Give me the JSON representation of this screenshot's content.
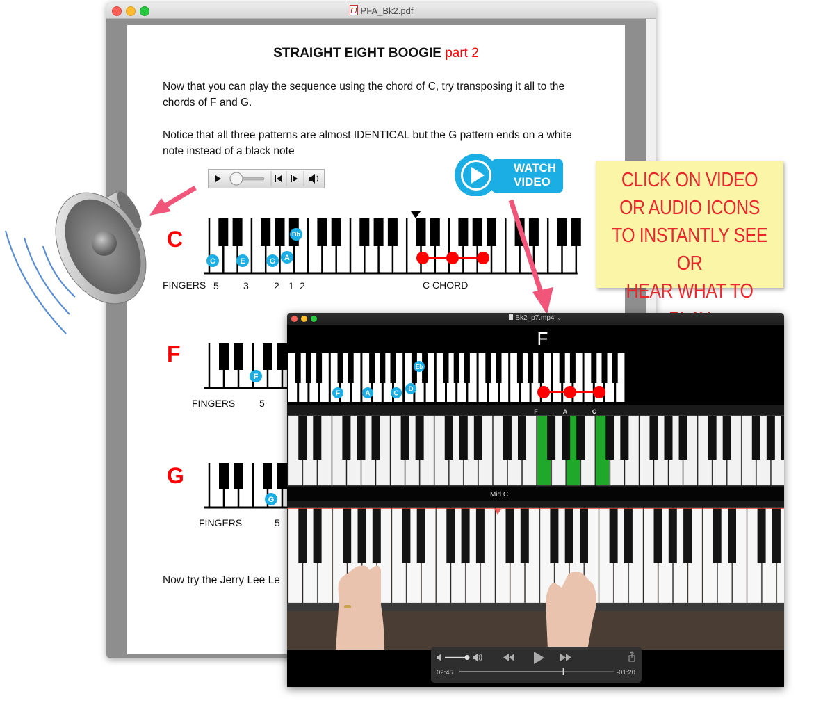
{
  "pdf_window": {
    "title": "PFA_Bk2.pdf",
    "doc_title_main": "STRAIGHT EIGHT BOOGIE",
    "doc_title_suffix": "part 2",
    "paragraph1": "Now that you can play the sequence using the chord of C, try transposing it all to the chords of F and G.",
    "paragraph2": "Notice that all three patterns are almost IDENTICAL  but the G pattern ends on a white note instead of a black note",
    "paragraph3": "Now try the Jerry Lee Le",
    "sections": [
      {
        "chord": "C",
        "fingers_label": "FINGERS",
        "finger_numbers": [
          "5",
          "3",
          "2",
          "1",
          "2"
        ],
        "note_labels": [
          "C",
          "E",
          "G",
          "A",
          "Bb"
        ],
        "chord_label": "C CHORD"
      },
      {
        "chord": "F",
        "fingers_label": "FINGERS",
        "finger_numbers": [
          "5"
        ],
        "note_labels": [
          "F"
        ]
      },
      {
        "chord": "G",
        "fingers_label": "FINGERS",
        "finger_numbers": [
          "5"
        ],
        "note_labels": [
          "G"
        ]
      }
    ],
    "audio_player": {
      "play": "play-icon",
      "prev": "step-back-icon",
      "next": "step-forward-icon",
      "volume": "volume-icon"
    }
  },
  "watch_video": {
    "line1": "WATCH",
    "line2": "VIDEO",
    "color": "#1aaee5"
  },
  "sticky_note": {
    "lines": [
      "CLICK ON VIDEO",
      "OR AUDIO ICONS",
      "TO INSTANTLY SEE OR",
      "HEAR WHAT TO PLAY"
    ],
    "text_color": "#e8282d",
    "bg_color": "#fbf5a8"
  },
  "video_window": {
    "title": "Bk2_p7.mp4",
    "chord": "F",
    "note_labels": [
      "F",
      "A",
      "C",
      "D",
      "Eb"
    ],
    "keyboard_labels": [
      "F",
      "A",
      "C"
    ],
    "mid_c_label": "Mid C",
    "current_time": "02:45",
    "remaining_time": "-01:20",
    "progress_fraction": 0.67,
    "volume_fraction": 1.0,
    "highlight_color": "#1fa82a"
  },
  "colors": {
    "accent_red": "#ff0000",
    "note_blue": "#1aaee5",
    "arrow_pink": "#f2557a"
  }
}
